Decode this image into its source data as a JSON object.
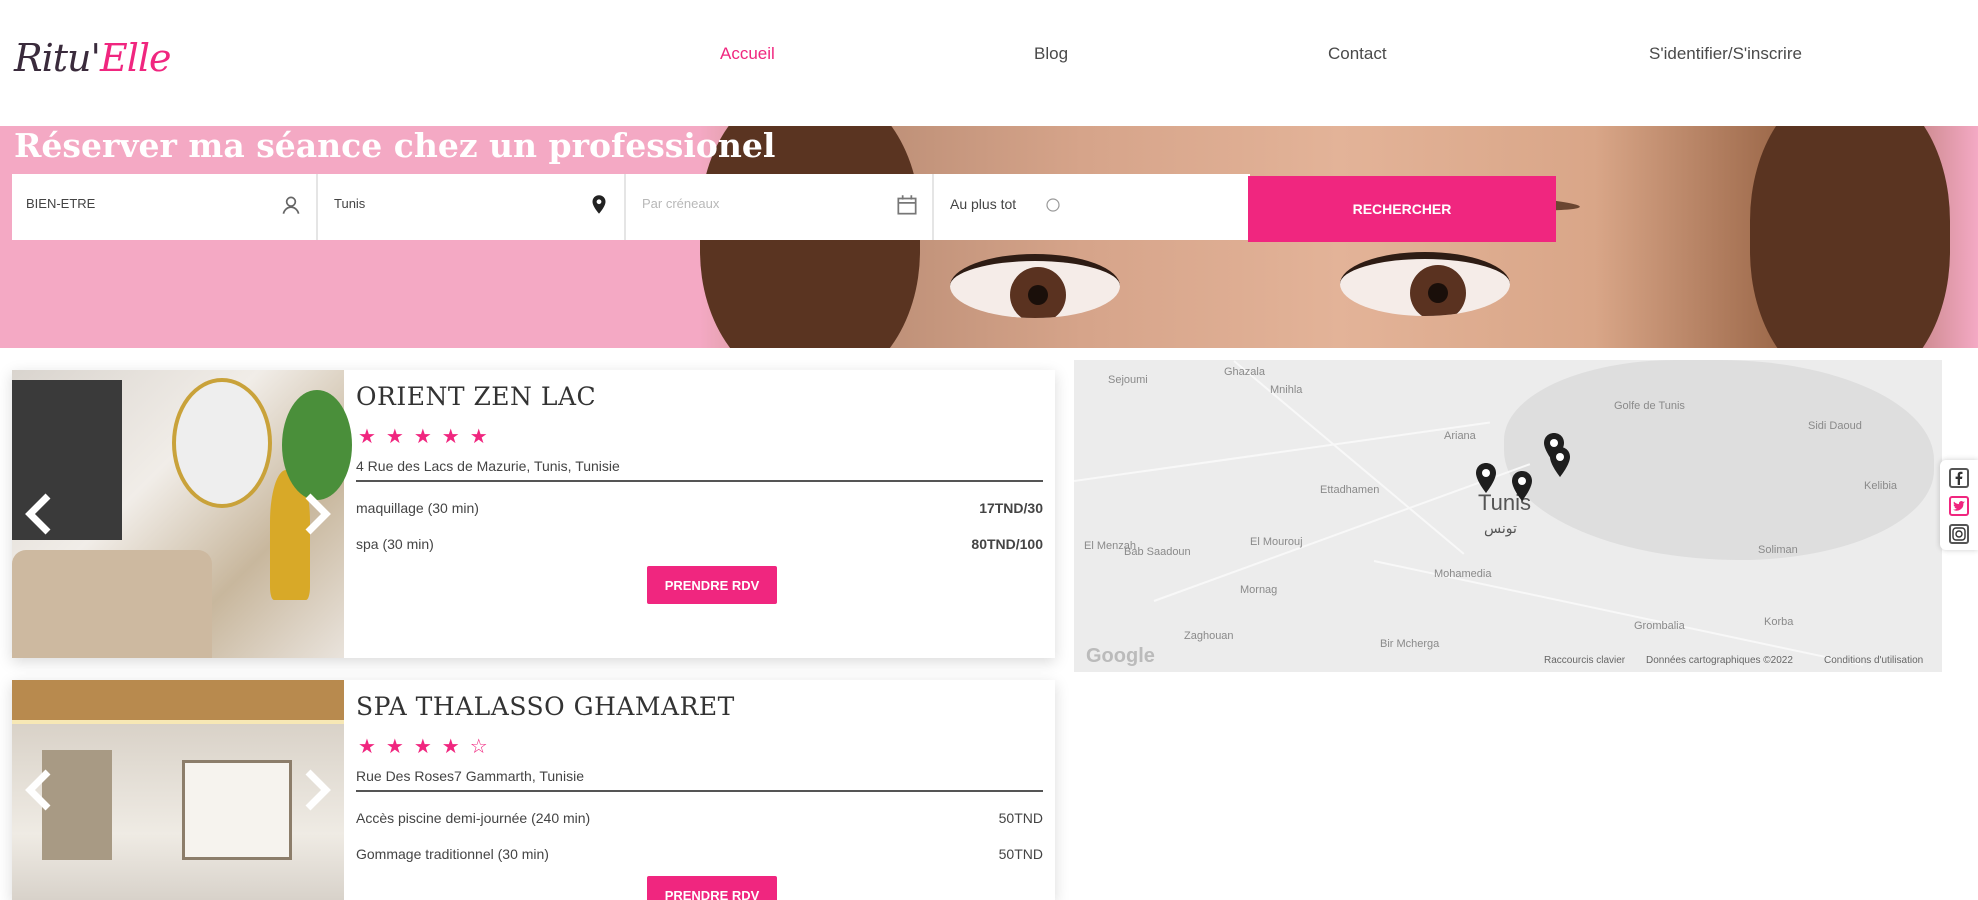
{
  "header": {
    "logo_part1": "Ritu'",
    "logo_part2": "Elle",
    "nav": [
      "Accueil",
      "Blog",
      "Contact",
      "S'identifier/S'inscrire"
    ],
    "active_nav": "Accueil"
  },
  "hero": {
    "title": "Réserver ma séance chez un professionel",
    "search": {
      "service_value": "BIEN-ETRE",
      "city_value": "Tunis",
      "date_placeholder": "Par créneaux",
      "time_value": "Au plus tot",
      "button": "RECHERCHER"
    }
  },
  "cards": [
    {
      "title": "ORIENT ZEN LAC",
      "stars": "★★★★★",
      "rating": 5,
      "address": "4 Rue des Lacs de Mazurie, Tunis, Tunisie",
      "services": [
        {
          "name": "maquillage (30 min)",
          "price": "17TND/30"
        },
        {
          "name": "spa (30 min)",
          "price": "80TND/100"
        }
      ],
      "button": "PRENDRE RDV"
    },
    {
      "title": "SPA THALASSO GHAMARET",
      "stars": "★★★★☆",
      "rating": 4,
      "address": "Rue Des Roses7 Gammarth, Tunisie",
      "services": [
        {
          "name": "Accès piscine demi-journée (240 min)",
          "price": "50TND"
        },
        {
          "name": "Gommage traditionnel (30 min)",
          "price": "50TND"
        }
      ],
      "button": "PRENDRE RDV"
    }
  ],
  "map": {
    "city": "Tunis",
    "city_ar": "تونس",
    "places": [
      "Sejoumi",
      "Ghazala",
      "Mnihla",
      "Ettadhamen",
      "Ariana",
      "Golfe de Tunis",
      "Sidi Daoud",
      "Kelibia",
      "El Menzah",
      "Bab Saadoun",
      "El Mourouj",
      "Mohamedia",
      "Mornag",
      "Soliman",
      "Bir Mcherga",
      "Zaghouan",
      "Korba",
      "Grombalia"
    ],
    "footer": {
      "shortcuts": "Raccourcis clavier",
      "data": "Données cartographiques ©2022",
      "terms": "Conditions d'utilisation"
    },
    "google": "Google"
  },
  "social": [
    "facebook-icon",
    "twitter-icon",
    "instagram-icon"
  ],
  "colors": {
    "accent": "#f0267f",
    "hero_pink": "#f4a9c4"
  }
}
